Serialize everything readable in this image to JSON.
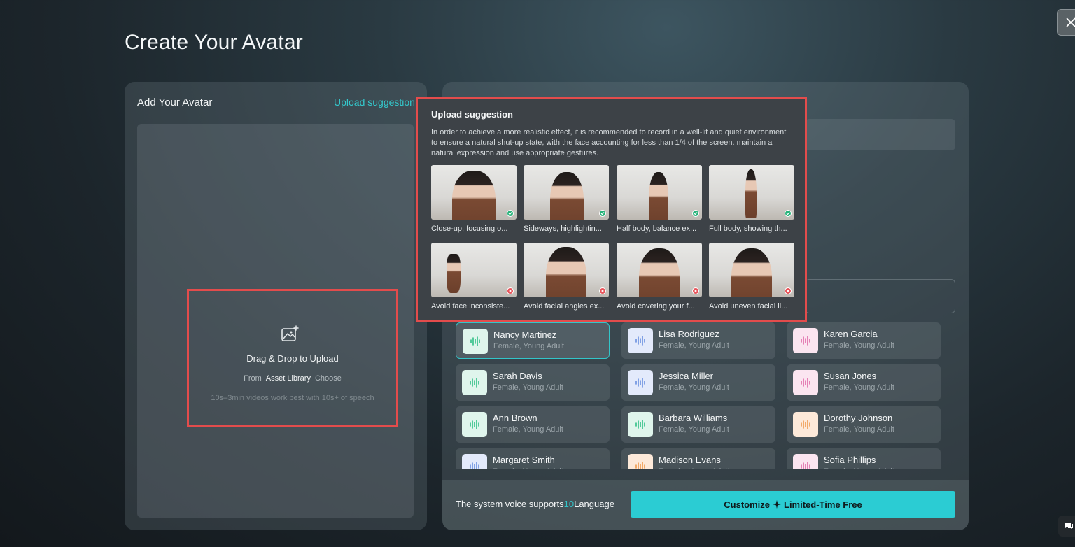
{
  "page": {
    "title": "Create Your Avatar"
  },
  "left_panel": {
    "title": "Add Your Avatar",
    "suggestion_link": "Upload suggestion",
    "upload": {
      "title": "Drag & Drop to Upload",
      "from_label": "From",
      "asset_library": "Asset Library",
      "choose": "Choose",
      "hint": "10s–3min videos work best with 10s+ of speech"
    }
  },
  "popover": {
    "title": "Upload suggestion",
    "description": "In order to achieve a more realistic effect, it is recommended to record in a well-lit and quiet environment to ensure a natural shut-up state, with the face accounting for less than 1/4 of the screen. maintain a natural expression and use appropriate gestures.",
    "examples": [
      {
        "caption": "Close-up, focusing o...",
        "status": "ok"
      },
      {
        "caption": "Sideways, highlightin...",
        "status": "ok"
      },
      {
        "caption": "Half body, balance ex...",
        "status": "ok"
      },
      {
        "caption": "Full body, showing th...",
        "status": "ok"
      },
      {
        "caption": "Avoid face inconsiste...",
        "status": "bad"
      },
      {
        "caption": "Avoid facial angles ex...",
        "status": "bad"
      },
      {
        "caption": "Avoid covering your f...",
        "status": "bad"
      },
      {
        "caption": "Avoid uneven facial li...",
        "status": "bad"
      }
    ]
  },
  "voices": [
    {
      "name": "Nancy Martinez",
      "meta": "Female, Young Adult",
      "color": "#2fbf86",
      "bg": "#dff5ec",
      "selected": true
    },
    {
      "name": "Lisa Rodriguez",
      "meta": "Female, Young Adult",
      "color": "#6a8fe0",
      "bg": "#e3eafb",
      "selected": false
    },
    {
      "name": "Karen Garcia",
      "meta": "Female, Young Adult",
      "color": "#e068a8",
      "bg": "#fbe5f0",
      "selected": false
    },
    {
      "name": "Sarah Davis",
      "meta": "Female, Young Adult",
      "color": "#2fbf86",
      "bg": "#dff5ec",
      "selected": false
    },
    {
      "name": "Jessica Miller",
      "meta": "Female, Young Adult",
      "color": "#6a8fe0",
      "bg": "#e3eafb",
      "selected": false
    },
    {
      "name": "Susan Jones",
      "meta": "Female, Young Adult",
      "color": "#e068a8",
      "bg": "#fbe5f0",
      "selected": false
    },
    {
      "name": "Ann Brown",
      "meta": "Female, Young Adult",
      "color": "#2fbf86",
      "bg": "#dff5ec",
      "selected": false
    },
    {
      "name": "Barbara Williams",
      "meta": "Female, Young Adult",
      "color": "#2fbf86",
      "bg": "#dff5ec",
      "selected": false
    },
    {
      "name": "Dorothy Johnson",
      "meta": "Female, Young Adult",
      "color": "#ef9a4e",
      "bg": "#fde9d9",
      "selected": false
    },
    {
      "name": "Margaret Smith",
      "meta": "Female, Young Adult",
      "color": "#6a8fe0",
      "bg": "#e3eafb",
      "selected": false
    },
    {
      "name": "Madison Evans",
      "meta": "Female, Young Adult",
      "color": "#ef9a4e",
      "bg": "#fde9d9",
      "selected": false
    },
    {
      "name": "Sofia Phillips",
      "meta": "Female, Young Adult",
      "color": "#e068a8",
      "bg": "#fbe5f0",
      "selected": false
    }
  ],
  "footer": {
    "support_prefix": "The system voice supports",
    "support_count": "10",
    "support_suffix": "Language",
    "customize_label": "Customize",
    "customize_free": "Limited-Time Free"
  },
  "colors": {
    "accent": "#2bccd3",
    "highlight_border": "#e34c4c"
  }
}
